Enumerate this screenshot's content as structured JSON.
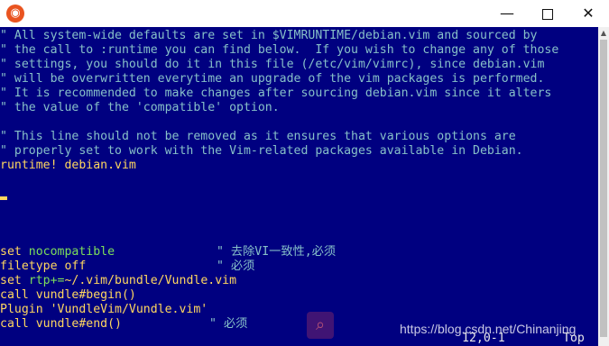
{
  "window": {
    "app_icon": "ubuntu-logo-icon",
    "min_glyph": "—",
    "close_glyph": "✕"
  },
  "comments": [
    "\" All system-wide defaults are set in $VIMRUNTIME/debian.vim and sourced by",
    "\" the call to :runtime you can find below.  If you wish to change any of those",
    "\" settings, you should do it in this file (/etc/vim/vimrc), since debian.vim",
    "\" will be overwritten everytime an upgrade of the vim packages is performed.",
    "\" It is recommended to make changes after sourcing debian.vim since it alters",
    "\" the value of the 'compatible' option.",
    "\" This line should not be removed as it ensures that various options are",
    "\" properly set to work with the Vim-related packages available in Debian."
  ],
  "runtime_line": {
    "keyword": "runtime!",
    "arg": " debian.vim"
  },
  "config": {
    "l1_cmd": "set ",
    "l1_opt": "nocompatible",
    "l1_comment": "\" 去除VI一致性,必须",
    "l2_cmd": "filetype off",
    "l2_comment": "\" 必须",
    "l3_cmd": "set ",
    "l3_opt": "rtp+=",
    "l3_val": "~/.vim/bundle/Vundle.vim",
    "l4_cmd": "call vundle#begin()",
    "l5_cmd": "Plugin ",
    "l5_val": "'VundleVim/Vundle.vim'",
    "l6_cmd": "call vundle#end()",
    "l6_comment": "\" 必须"
  },
  "status": {
    "position": "12,0-1",
    "scroll": "Top"
  },
  "watermark": {
    "text": "https://blog.csdn.net/Chinanjing",
    "icon": "search-icon"
  },
  "colors": {
    "background": "#000080",
    "comment": "#87c0c8",
    "keyword": "#ffd75f",
    "option": "#7ddf5a"
  }
}
